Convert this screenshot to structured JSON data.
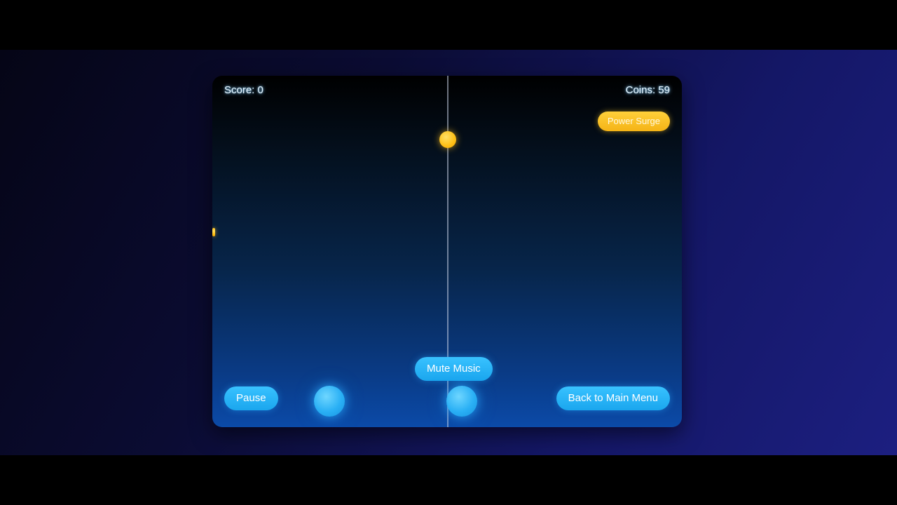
{
  "hud": {
    "score_text": "Score: 0",
    "coins_text": "Coins: 59"
  },
  "powerup": {
    "label": "Power Surge"
  },
  "controls": {
    "mute_label": "Mute Music",
    "pause_label": "Pause",
    "menu_label": "Back to Main Menu"
  },
  "colors": {
    "accent_blue": "#1aa6ee",
    "coin_gold": "#ffc21a",
    "powerup_gold": "#f5b416"
  },
  "icons": {
    "coin": "coin-icon",
    "orb": "player-orb"
  }
}
